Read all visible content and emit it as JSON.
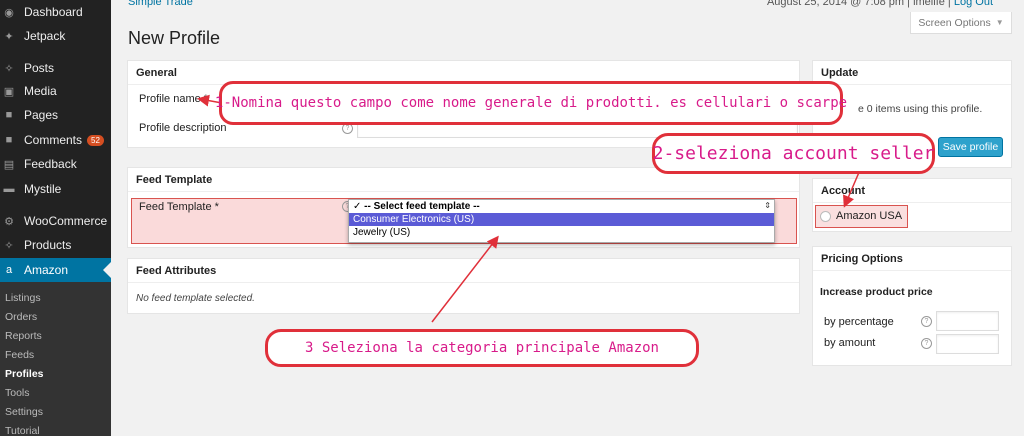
{
  "sidebar": {
    "items": [
      {
        "label": "Dashboard",
        "icon": "dashboard-icon"
      },
      {
        "label": "Jetpack",
        "icon": "jetpack-icon"
      },
      {
        "label": "Posts",
        "icon": "pin-icon"
      },
      {
        "label": "Media",
        "icon": "media-icon"
      },
      {
        "label": "Pages",
        "icon": "page-icon"
      },
      {
        "label": "Comments",
        "icon": "comment-icon",
        "badge": "52"
      },
      {
        "label": "Feedback",
        "icon": "feedback-icon"
      },
      {
        "label": "Mystile",
        "icon": "monitor-icon"
      },
      {
        "label": "WooCommerce",
        "icon": "gear-icon"
      },
      {
        "label": "Products",
        "icon": "pin-icon"
      },
      {
        "label": "Amazon",
        "icon": "amazon-icon",
        "active": true
      }
    ],
    "submenu": [
      "Listings",
      "Orders",
      "Reports",
      "Feeds",
      "Profiles",
      "Tools",
      "Settings",
      "Tutorial"
    ],
    "submenu_current": "Profiles"
  },
  "header": {
    "breadcrumb": "Simple Trade",
    "date": "August 25, 2014 @ 7:08 pm",
    "user": "imelife",
    "logout": "Log Out",
    "screen_options": "Screen Options"
  },
  "page_title": "New Profile",
  "general": {
    "title": "General",
    "profile_name_label": "Profile name *",
    "profile_description_label": "Profile description"
  },
  "feed_template": {
    "title": "Feed Template",
    "label": "Feed Template *",
    "options": [
      "-- Select feed template --",
      "Consumer Electronics (US)",
      "Jewelry (US)"
    ],
    "selected": "-- Select feed template --",
    "highlighted": "Consumer Electronics (US)"
  },
  "feed_attributes": {
    "title": "Feed Attributes",
    "empty_text": "No feed template selected."
  },
  "update": {
    "title": "Update",
    "items_text": "e 0 items using this profile.",
    "save_label": "Save profile"
  },
  "account": {
    "title": "Account",
    "option": "Amazon USA"
  },
  "pricing": {
    "title": "Pricing Options",
    "subtitle": "Increase product price",
    "by_percentage": "by percentage",
    "by_amount": "by amount"
  },
  "annotations": {
    "a1": "1-Nomina questo campo come nome generale di prodotti. es cellulari o scarpe",
    "a2": "2-seleziona account seller",
    "a3": "3 Seleziona la categoria principale Amazon"
  },
  "colors": {
    "sidebar_bg": "#222222",
    "active_menu": "#0074a2",
    "primary_button": "#2ea2cc",
    "annotation_border": "#e0303a",
    "annotation_text": "#d81b8a"
  }
}
